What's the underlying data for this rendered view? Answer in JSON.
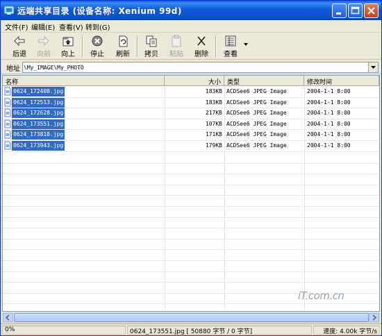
{
  "window": {
    "title": "远端共享目录 (设备名称: Xenium 99d)"
  },
  "menu": [
    {
      "label": "文件(F)"
    },
    {
      "label": "编辑(E)"
    },
    {
      "label": "查看(V)"
    },
    {
      "label": "转到(G)"
    }
  ],
  "toolbar": {
    "back": "后退",
    "forward": "向前",
    "up": "向上",
    "stop": "停止",
    "refresh": "刷新",
    "copy": "拷贝",
    "paste": "粘贴",
    "delete": "删除",
    "view": "查看"
  },
  "address": {
    "label": "地址",
    "value": "\\My_IMAGE\\My_PHOTO"
  },
  "columns": {
    "name": "名称",
    "size": "大小",
    "type": "类型",
    "modified": "修改时间"
  },
  "files": [
    {
      "name": "0624_172408.jpg",
      "size": "183KB",
      "type": "ACDSee6 JPEG Image",
      "modified": "2004-1-1 8:00"
    },
    {
      "name": "0624_172513.jpg",
      "size": "183KB",
      "type": "ACDSee6 JPEG Image",
      "modified": "2004-1-1 8:00"
    },
    {
      "name": "0624_172628.jpg",
      "size": "217KB",
      "type": "ACDSee6 JPEG Image",
      "modified": "2004-1-1 8:00"
    },
    {
      "name": "0624_173551.jpg",
      "size": "107KB",
      "type": "ACDSee6 JPEG Image",
      "modified": "2004-1-1 8:00"
    },
    {
      "name": "0624_173818.jpg",
      "size": "171KB",
      "type": "ACDSee6 JPEG Image",
      "modified": "2004-1-1 8:00"
    },
    {
      "name": "0624_173943.jpg",
      "size": "179KB",
      "type": "ACDSee6 JPEG Image",
      "modified": "2004-1-1 8:00"
    }
  ],
  "watermark": "iT.com.cn",
  "status": {
    "progress": "0%",
    "transfer": "0624_173551.jpg [ 50880 字节 / 0 字节]",
    "speed": "速度: 4.00k 字节/s"
  },
  "colors": {
    "titlebar": "#0a5fd8",
    "selection": "#316ac5",
    "chrome": "#ece9d8"
  }
}
